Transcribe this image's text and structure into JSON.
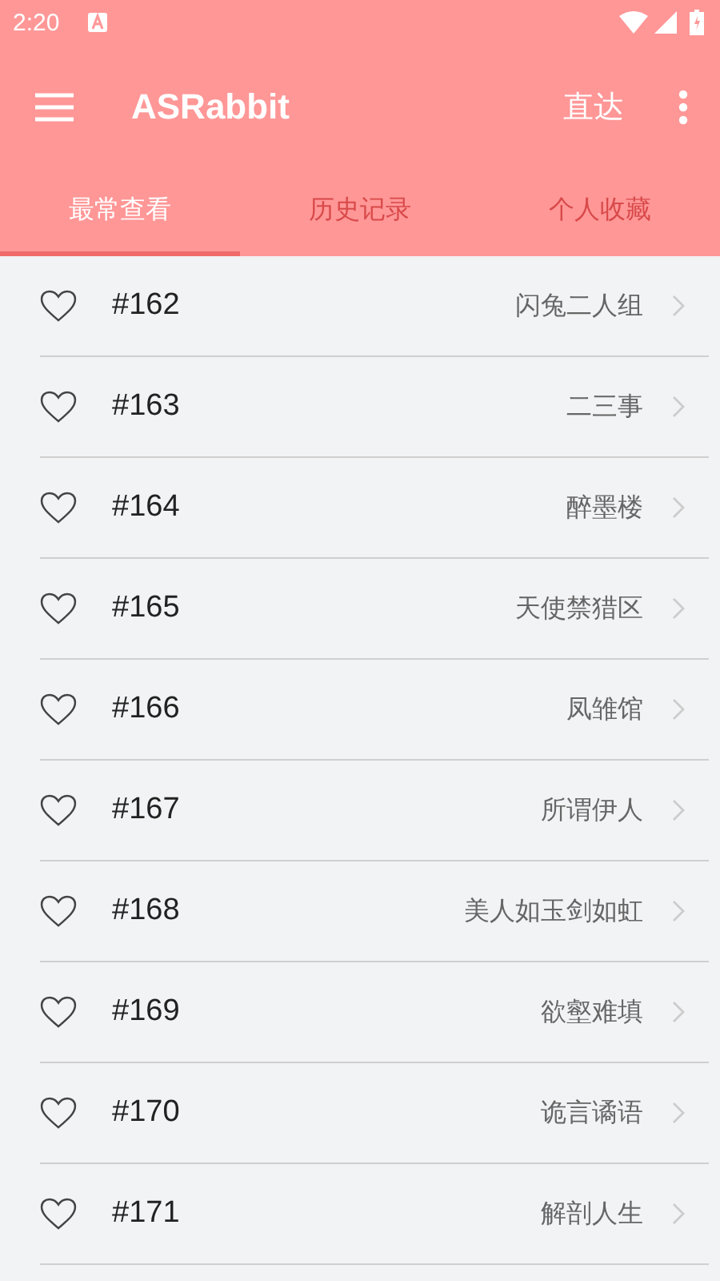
{
  "status_bar": {
    "time": "2:20"
  },
  "app_bar": {
    "title": "ASRabbit",
    "action": "直达"
  },
  "tabs": [
    {
      "label": "最常查看",
      "selected": true
    },
    {
      "label": "历史记录",
      "selected": false
    },
    {
      "label": "个人收藏",
      "selected": false
    }
  ],
  "items": [
    {
      "number": "#162",
      "name": "闪兔二人组",
      "liked": false
    },
    {
      "number": "#163",
      "name": "二三事",
      "liked": false
    },
    {
      "number": "#164",
      "name": "醉墨楼",
      "liked": false
    },
    {
      "number": "#165",
      "name": "天使禁猎区",
      "liked": false
    },
    {
      "number": "#166",
      "name": "凤雏馆",
      "liked": false
    },
    {
      "number": "#167",
      "name": "所谓伊人",
      "liked": false
    },
    {
      "number": "#168",
      "name": "美人如玉剑如虹",
      "liked": false
    },
    {
      "number": "#169",
      "name": "欲壑难填",
      "liked": false
    },
    {
      "number": "#170",
      "name": "诡言谲语",
      "liked": false
    },
    {
      "number": "#171",
      "name": "解剖人生",
      "liked": false
    }
  ]
}
